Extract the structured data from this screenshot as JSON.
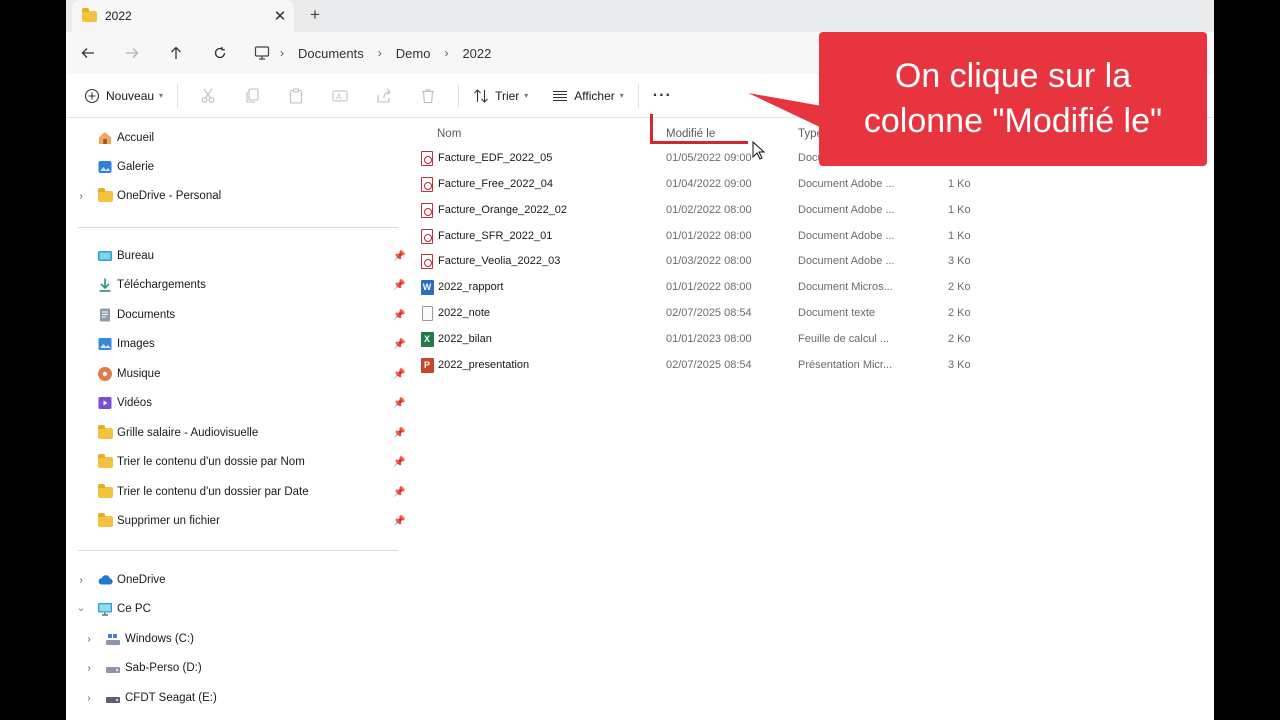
{
  "tab": {
    "title": "2022",
    "close_glyph": "✕",
    "new_tab_glyph": "+"
  },
  "address_bar": {
    "breadcrumbs": [
      "Documents",
      "Demo",
      "2022"
    ]
  },
  "command_bar": {
    "new_label": "Nouveau",
    "sort_label": "Trier",
    "view_label": "Afficher",
    "more_glyph": "···"
  },
  "sidebar": {
    "top_items": [
      {
        "label": "Accueil",
        "icon": "home-icon"
      },
      {
        "label": "Galerie",
        "icon": "gallery-icon"
      },
      {
        "label": "OneDrive - Personal",
        "icon": "folder-icon"
      }
    ],
    "pinned_items": [
      {
        "label": "Bureau",
        "icon": "desktop-icon"
      },
      {
        "label": "Téléchargements",
        "icon": "download-icon"
      },
      {
        "label": "Documents",
        "icon": "documents-icon"
      },
      {
        "label": "Images",
        "icon": "images-icon"
      },
      {
        "label": "Musique",
        "icon": "music-icon"
      },
      {
        "label": "Vidéos",
        "icon": "videos-icon"
      },
      {
        "label": "Grille salaire - Audiovisuelle",
        "icon": "folder-icon"
      },
      {
        "label": "Trier le contenu d'un dossie par Nom",
        "icon": "folder-icon"
      },
      {
        "label": "Trier le contenu d'un dossier par Date",
        "icon": "folder-icon"
      },
      {
        "label": "Supprimer un fichier",
        "icon": "folder-icon"
      }
    ],
    "bottom_items": [
      {
        "label": "OneDrive",
        "icon": "cloud-icon"
      },
      {
        "label": "Ce PC",
        "icon": "pc-icon"
      },
      {
        "label": "Windows (C:)",
        "icon": "drive-icon"
      },
      {
        "label": "Sab-Perso (D:)",
        "icon": "drive-icon"
      },
      {
        "label": "CFDT Seagat (E:)",
        "icon": "drive-icon"
      }
    ]
  },
  "columns": {
    "name": "Nom",
    "modified": "Modifié le",
    "type": "Type"
  },
  "files": [
    {
      "name": "Facture_EDF_2022_05",
      "modified": "01/05/2022 09:00",
      "type": "Docu",
      "size": "",
      "kind": "pdf"
    },
    {
      "name": "Facture_Free_2022_04",
      "modified": "01/04/2022 09:00",
      "type": "Document Adobe ...",
      "size": "1 Ko",
      "kind": "pdf"
    },
    {
      "name": "Facture_Orange_2022_02",
      "modified": "01/02/2022 08:00",
      "type": "Document Adobe ...",
      "size": "1 Ko",
      "kind": "pdf"
    },
    {
      "name": "Facture_SFR_2022_01",
      "modified": "01/01/2022 08:00",
      "type": "Document Adobe ...",
      "size": "1 Ko",
      "kind": "pdf"
    },
    {
      "name": "Facture_Veolia_2022_03",
      "modified": "01/03/2022 08:00",
      "type": "Document Adobe ...",
      "size": "3 Ko",
      "kind": "pdf"
    },
    {
      "name": "2022_rapport",
      "modified": "01/01/2022 08:00",
      "type": "Document Micros...",
      "size": "2 Ko",
      "kind": "word"
    },
    {
      "name": "2022_note",
      "modified": "02/07/2025 08:54",
      "type": "Document texte",
      "size": "2 Ko",
      "kind": "text"
    },
    {
      "name": "2022_bilan",
      "modified": "01/01/2023 08:00",
      "type": "Feuille de calcul ...",
      "size": "2 Ko",
      "kind": "excel"
    },
    {
      "name": "2022_presentation",
      "modified": "02/07/2025 08:54",
      "type": "Présentation Micr...",
      "size": "3 Ko",
      "kind": "powerpoint"
    }
  ],
  "annotation": {
    "text_line1": "On clique sur la",
    "text_line2": "colonne \"Modifié le\"",
    "color": "#e8343f"
  },
  "colors": {
    "accent_red": "#d9232e",
    "folder_yellow": "#f3c340"
  }
}
